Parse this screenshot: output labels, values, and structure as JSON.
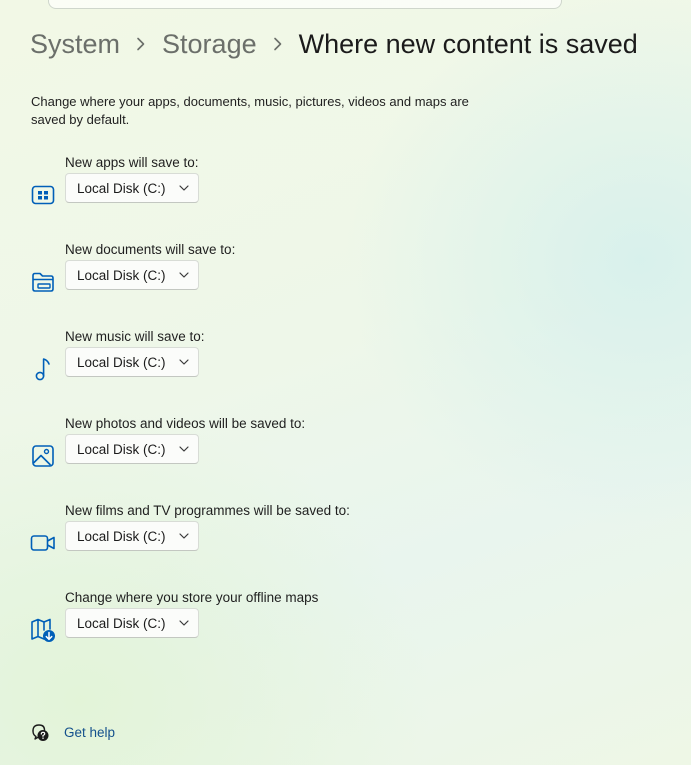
{
  "breadcrumb": {
    "items": [
      "System",
      "Storage"
    ],
    "current": "Where new content is saved"
  },
  "description": "Change where your apps, documents, music, pictures, videos and maps are saved by default.",
  "settings": [
    {
      "label": "New apps will save to:",
      "value": "Local Disk (C:)",
      "icon": "apps-icon"
    },
    {
      "label": "New documents will save to:",
      "value": "Local Disk (C:)",
      "icon": "folder-icon"
    },
    {
      "label": "New music will save to:",
      "value": "Local Disk (C:)",
      "icon": "music-note-icon"
    },
    {
      "label": "New photos and videos will be saved to:",
      "value": "Local Disk (C:)",
      "icon": "image-icon"
    },
    {
      "label": "New films and TV programmes will be saved to:",
      "value": "Local Disk (C:)",
      "icon": "video-camera-icon"
    },
    {
      "label": "Change where you store your offline maps",
      "value": "Local Disk (C:)",
      "icon": "map-download-icon"
    }
  ],
  "help": {
    "label": "Get help",
    "icon": "help-chat-icon"
  },
  "colors": {
    "icon_accent": "#005fb8",
    "link": "#14508c",
    "breadcrumb_parent": "#6b6f6a"
  }
}
